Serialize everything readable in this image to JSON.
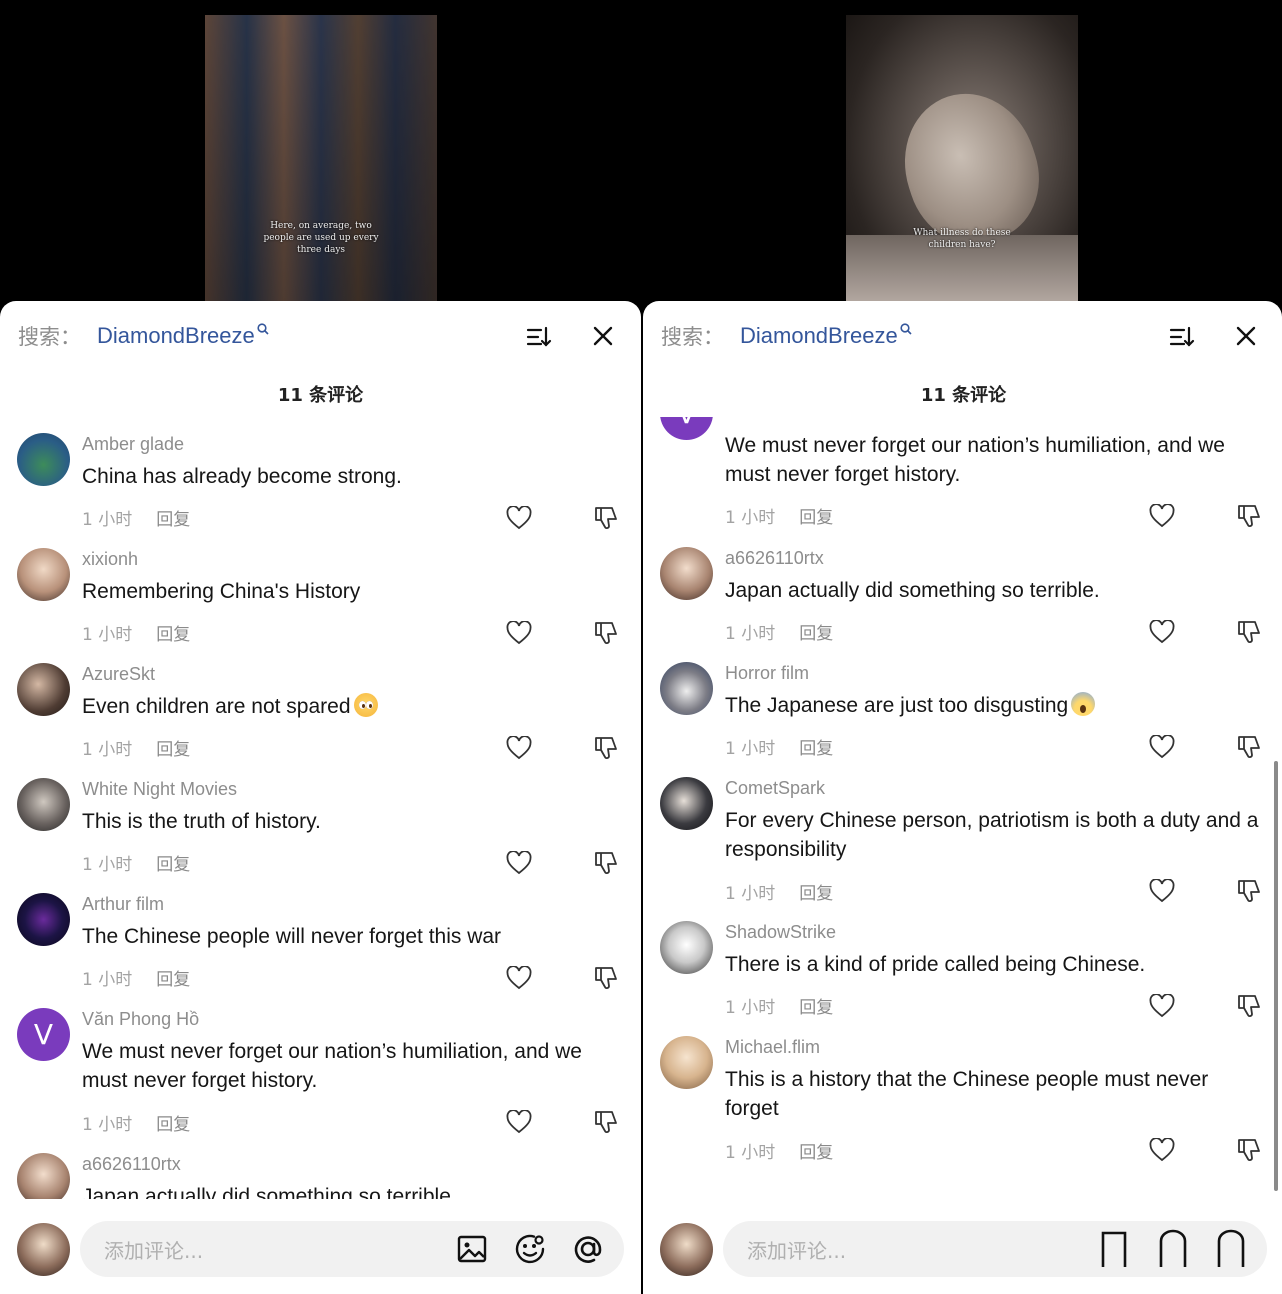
{
  "left_panel": {
    "video_caption": "Here, on average, two people are used up every three days",
    "search": {
      "prefix": "搜索：",
      "term": "DiamondBreeze"
    },
    "comment_count": "11 条评论",
    "comments": [
      {
        "author": "Amber glade",
        "text": "China has already become strong.",
        "time": "1 小时",
        "reply": "回复"
      },
      {
        "author": "xixionh",
        "text": "Remembering China's History",
        "time": "1 小时",
        "reply": "回复"
      },
      {
        "author": "AzureSkt",
        "text": "Even children are not spared",
        "time": "1 小时",
        "reply": "回复",
        "emoji": "pleading-face"
      },
      {
        "author": "White Night Movies",
        "text": "This is the truth of history.",
        "time": "1 小时",
        "reply": "回复"
      },
      {
        "author": "Arthur film",
        "text": "The Chinese people will never forget this war",
        "time": "1 小时",
        "reply": "回复"
      },
      {
        "author": "Văn Phong Hồ",
        "avatar_letter": "V",
        "text": "We must never forget our nation’s humiliation, and we must never forget history.",
        "time": "1 小时",
        "reply": "回复"
      },
      {
        "author": "a6626110rtx",
        "text": "Japan actually did something so terrible."
      }
    ],
    "input_placeholder": "添加评论..."
  },
  "right_panel": {
    "video_caption": "What illness do these children have?",
    "search": {
      "prefix": "搜索：",
      "term": "DiamondBreeze"
    },
    "comment_count": "11 条评论",
    "comments": [
      {
        "avatar_letter": "V",
        "text": "We must never forget our nation’s humiliation, and we must never forget history.",
        "time": "1 小时",
        "reply": "回复"
      },
      {
        "author": "a6626110rtx",
        "text": "Japan actually did something so terrible.",
        "time": "1 小时",
        "reply": "回复"
      },
      {
        "author": "Horror film",
        "text": "The Japanese are just too disgusting",
        "time": "1 小时",
        "reply": "回复",
        "emoji": "screaming-face"
      },
      {
        "author": "CometSpark",
        "text": "For every Chinese person, patriotism is both a duty and a responsibility",
        "time": "1 小时",
        "reply": "回复"
      },
      {
        "author": "ShadowStrike",
        "text": "There is a kind of pride called being Chinese.",
        "time": "1 小时",
        "reply": "回复"
      },
      {
        "author": "Michael.flim",
        "text": "This is a history that the Chinese people must never forget",
        "time": "1 小时",
        "reply": "回复"
      }
    ],
    "input_placeholder": "添加评论..."
  },
  "icons": {
    "sort": "sort-icon",
    "close": "close-icon",
    "like": "heart-icon",
    "dislike": "thumbs-down-icon",
    "image": "image-icon",
    "emoji": "emoji-icon",
    "mention": "at-icon"
  },
  "colors": {
    "search_term": "#34569b",
    "avatar_v": "#7a3bbd"
  }
}
